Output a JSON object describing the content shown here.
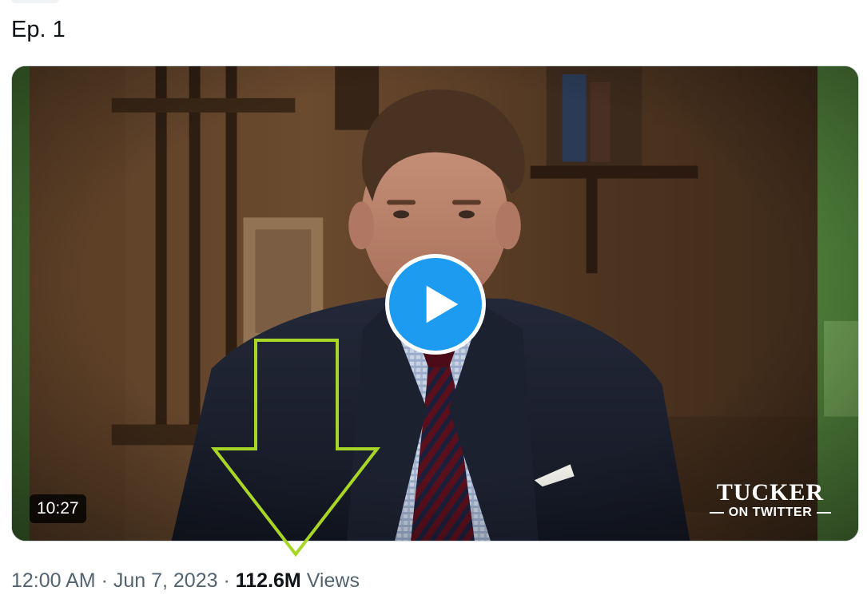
{
  "tweet": {
    "text": "Ep. 1"
  },
  "video": {
    "duration": "10:27",
    "play_icon": "play-icon",
    "watermark": {
      "name": "TUCKER",
      "subtitle": "ON TWITTER"
    }
  },
  "meta": {
    "time": "12:00 AM",
    "separator1": " · ",
    "date": "Jun 7, 2023",
    "separator2": " · ",
    "views_count": "112.6M",
    "views_label": " Views"
  },
  "annotation": {
    "arrow_color": "#a8d626",
    "arrow_icon": "down-arrow-icon"
  },
  "colors": {
    "accent": "#1d9bf0",
    "secondary_text": "#536471",
    "primary_text": "#0f1419"
  }
}
